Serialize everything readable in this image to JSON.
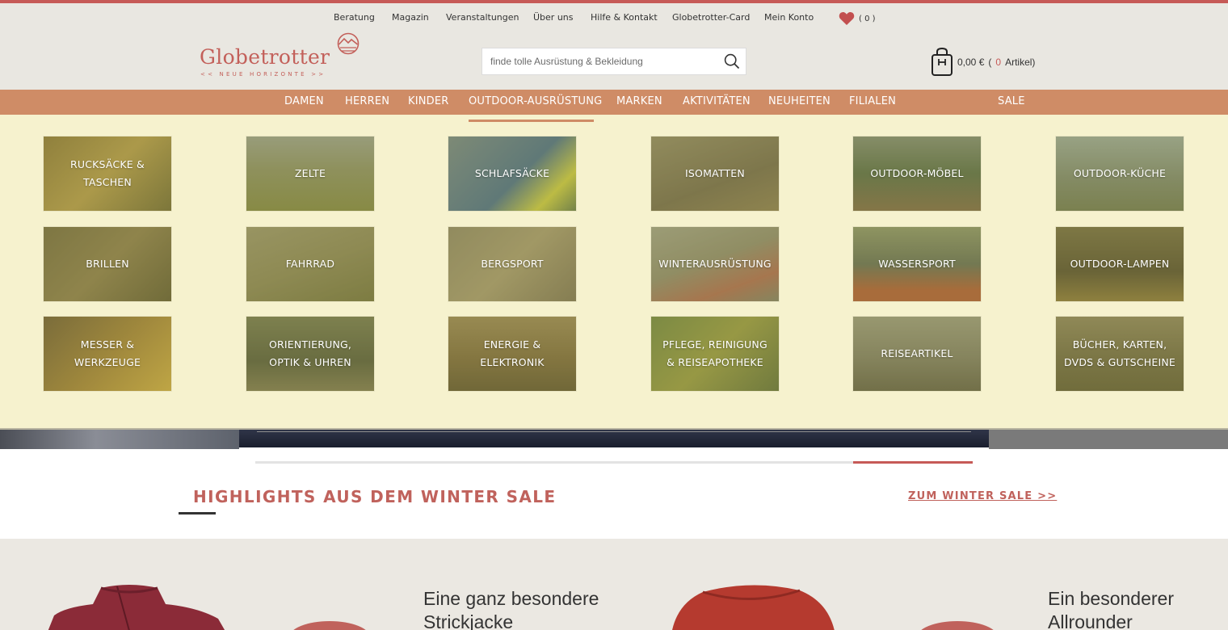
{
  "topnav": {
    "links": [
      "Beratung",
      "Magazin",
      "Veranstaltungen",
      "Über uns",
      "Hilfe & Kontakt",
      "Globetrotter-Card",
      "Mein Konto"
    ],
    "wishlist_count": "( 0 )"
  },
  "logo": {
    "name": "Globetrotter",
    "tagline": "<< NEUE HORIZONTE >>"
  },
  "search": {
    "placeholder": "finde tolle Ausrüstung & Bekleidung"
  },
  "cart": {
    "amount": "0,00 €",
    "open": "(",
    "count": "0",
    "label": "Artikel)"
  },
  "mainnav": {
    "items": [
      "DAMEN",
      "HERREN",
      "KINDER",
      "OUTDOOR-AUSRÜSTUNG",
      "MARKEN",
      "AKTIVITÄTEN",
      "NEUHEITEN",
      "FILIALEN",
      "SALE"
    ],
    "active": "OUTDOOR-AUSRÜSTUNG"
  },
  "categories": [
    [
      "RUCKSÄCKE & TASCHEN",
      "ZELTE",
      "SCHLAFSÄCKE",
      "ISOMATTEN",
      "OUTDOOR-MÖBEL",
      "OUTDOOR-KÜCHE"
    ],
    [
      "BRILLEN",
      "FAHRRAD",
      "BERGSPORT",
      "WINTERAUSRÜSTUNG",
      "WASSERSPORT",
      "OUTDOOR-LAMPEN"
    ],
    [
      "MESSER & WERKZEUGE",
      "ORIENTIERUNG, OPTIK & UHREN",
      "ENERGIE & ELEKTRONIK",
      "PFLEGE, REINIGUNG & REISEAPOTHEKE",
      "REISEARTIKEL",
      "BÜCHER, KARTEN, DVDS & GUTSCHEINE"
    ]
  ],
  "highlights": {
    "title": "HIGHLIGHTS AUS DEM WINTER SALE",
    "link": "ZUM WINTER SALE  >>"
  },
  "promos": [
    "Eine ganz besondere Strickjacke",
    "Ein besonderer Allrounder"
  ],
  "colors": {
    "brand": "#c65a57",
    "nav_bg": "#cf8c66",
    "flyout_bg": "#f6f2ce",
    "header_bg": "#e9e7e1"
  }
}
